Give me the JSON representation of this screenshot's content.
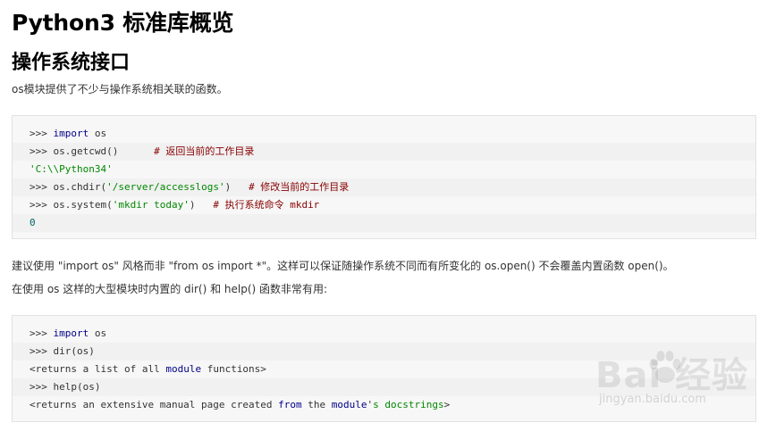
{
  "page": {
    "title": "Python3 标准库概览",
    "section_title": "操作系统接口",
    "intro": "os模块提供了不少与操作系统相关联的函数。",
    "para1": "建议使用 \"import os\" 风格而非 \"from os import *\"。这样可以保证随操作系统不同而有所变化的 os.open() 不会覆盖内置函数 open()。",
    "para2": "在使用 os 这样的大型模块时内置的 dir() 和 help() 函数非常有用:"
  },
  "code1": {
    "l1_prompt": ">>> ",
    "l1_kw": "import",
    "l1_rest": " os",
    "l2_prompt": ">>> ",
    "l2_code": "os.getcwd()",
    "l2_pad": "      ",
    "l2_comment": "# 返回当前的工作目录",
    "l3_str": "'C:\\\\Python34'",
    "l4_prompt": ">>> ",
    "l4_code_a": "os.chdir(",
    "l4_str": "'/server/accesslogs'",
    "l4_code_b": ")",
    "l4_pad": "   ",
    "l4_comment": "# 修改当前的工作目录",
    "l5_prompt": ">>> ",
    "l5_code_a": "os.system(",
    "l5_str": "'mkdir today'",
    "l5_code_b": ")",
    "l5_pad": "   ",
    "l5_comment": "# 执行系统命令 mkdir",
    "l6_num": "0"
  },
  "code2": {
    "l1_prompt": ">>> ",
    "l1_kw": "import",
    "l1_rest": " os",
    "l2_prompt": ">>> ",
    "l2_code": "dir(os)",
    "l3_a": "<returns a list of all ",
    "l3_kw": "module",
    "l3_b": " functions>",
    "l4_prompt": ">>> ",
    "l4_code": "help(os)",
    "l5_a": "<returns an extensive manual page created ",
    "l5_kw1": "from",
    "l5_b": " the ",
    "l5_kw2": "module",
    "l5_c": "'",
    "l5_str": "s docstrings",
    "l5_d": ">"
  },
  "watermark": {
    "main": "Bai  经验",
    "sub": "jingyan.baidu.com"
  }
}
